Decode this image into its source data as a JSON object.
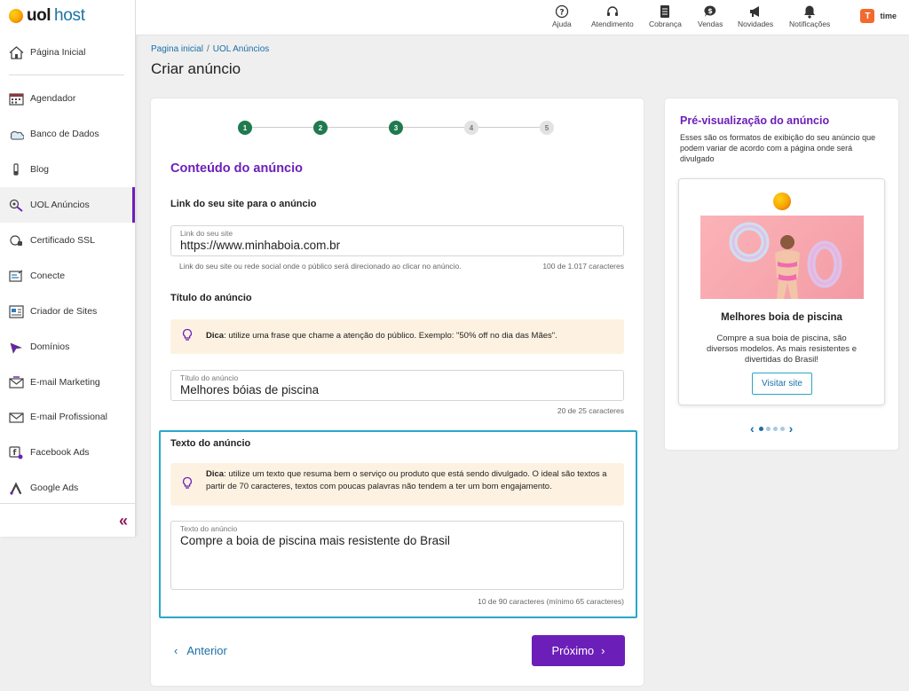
{
  "brand": {
    "uol": "uol",
    "host": "host"
  },
  "sidebar": {
    "home": "Página Inicial",
    "items": [
      {
        "label": "Agendador",
        "icon": "calendar-icon"
      },
      {
        "label": "Banco de Dados",
        "icon": "database-icon"
      },
      {
        "label": "Blog",
        "icon": "blog-icon"
      },
      {
        "label": "UOL Anúncios",
        "icon": "ads-icon",
        "active": true
      },
      {
        "label": "Certificado SSL",
        "icon": "ssl-certificate-icon"
      },
      {
        "label": "Conecte",
        "icon": "conecte-icon"
      },
      {
        "label": "Criador de Sites",
        "icon": "site-builder-icon"
      },
      {
        "label": "Domínios",
        "icon": "domains-icon"
      },
      {
        "label": "E-mail Marketing",
        "icon": "email-marketing-icon"
      },
      {
        "label": "E-mail Profissional",
        "icon": "email-icon"
      },
      {
        "label": "Facebook Ads",
        "icon": "facebook-ads-icon"
      },
      {
        "label": "Google Ads",
        "icon": "google-ads-icon"
      }
    ],
    "collapse": "«"
  },
  "topbar": {
    "items": [
      "Ajuda",
      "Atendimento",
      "Cobrança",
      "Vendas",
      "Novidades",
      "Notificações"
    ],
    "account_badge": "T",
    "account": "time"
  },
  "breadcrumb": {
    "home": "Pagina inicial",
    "current": "UOL Anúncios"
  },
  "page_title": "Criar anúncio",
  "steps": [
    "1",
    "2",
    "3",
    "4",
    "5"
  ],
  "steps_completed": 3,
  "section_title": "Conteúdo do anúncio",
  "link": {
    "heading": "Link do seu site para o anúncio",
    "label": "Link do seu site",
    "value": "https://www.minhaboia.com.br",
    "helper": "Link do seu site ou rede social onde o público será direcionado ao clicar no anúncio.",
    "counter": "100 de 1.017 caracteres"
  },
  "title": {
    "heading": "Título do anúncio",
    "tip_bold": "Dica",
    "tip": ": utilize uma frase que chame a atenção do público. Exemplo: \"50% off no dia das Mães\".",
    "label": "Título do anúncio",
    "value": "Melhores bóias de piscina",
    "counter": "20 de 25 caracteres"
  },
  "text": {
    "heading": "Texto do anúncio",
    "tip_bold": "Dica",
    "tip": ": utilize um texto que resuma bem o serviço ou produto que está sendo divulgado. O ideal são textos a partir de 70 caracteres, textos com poucas palavras não tendem a ter um bom engajamento.",
    "label": "Texto do anúncio",
    "value": "Compre a boia de piscina mais resistente do Brasil",
    "counter": "10 de 90 caracteres (mínimo 65 caracteres)"
  },
  "buttons": {
    "back": "Anterior",
    "next": "Próximo"
  },
  "preview": {
    "title": "Pré-visualização do anúncio",
    "description": "Esses são os formatos de exibição do seu anúncio que podem variar de acordo com a página onde será divulgado",
    "ad_title": "Melhores boia de piscina",
    "ad_description": "Compre a sua boia de piscina, são diversos modelos. As mais resistentes e divertidas do Brasil!",
    "ad_button": "Visitar site",
    "pages": 4,
    "active_page": 1
  },
  "colors": {
    "accent": "#6c1fb8",
    "link": "#1a6fa8",
    "step_done": "#1f7a4d",
    "focus_border": "#2ba7c8",
    "tip_bg": "#fdf2e1"
  }
}
